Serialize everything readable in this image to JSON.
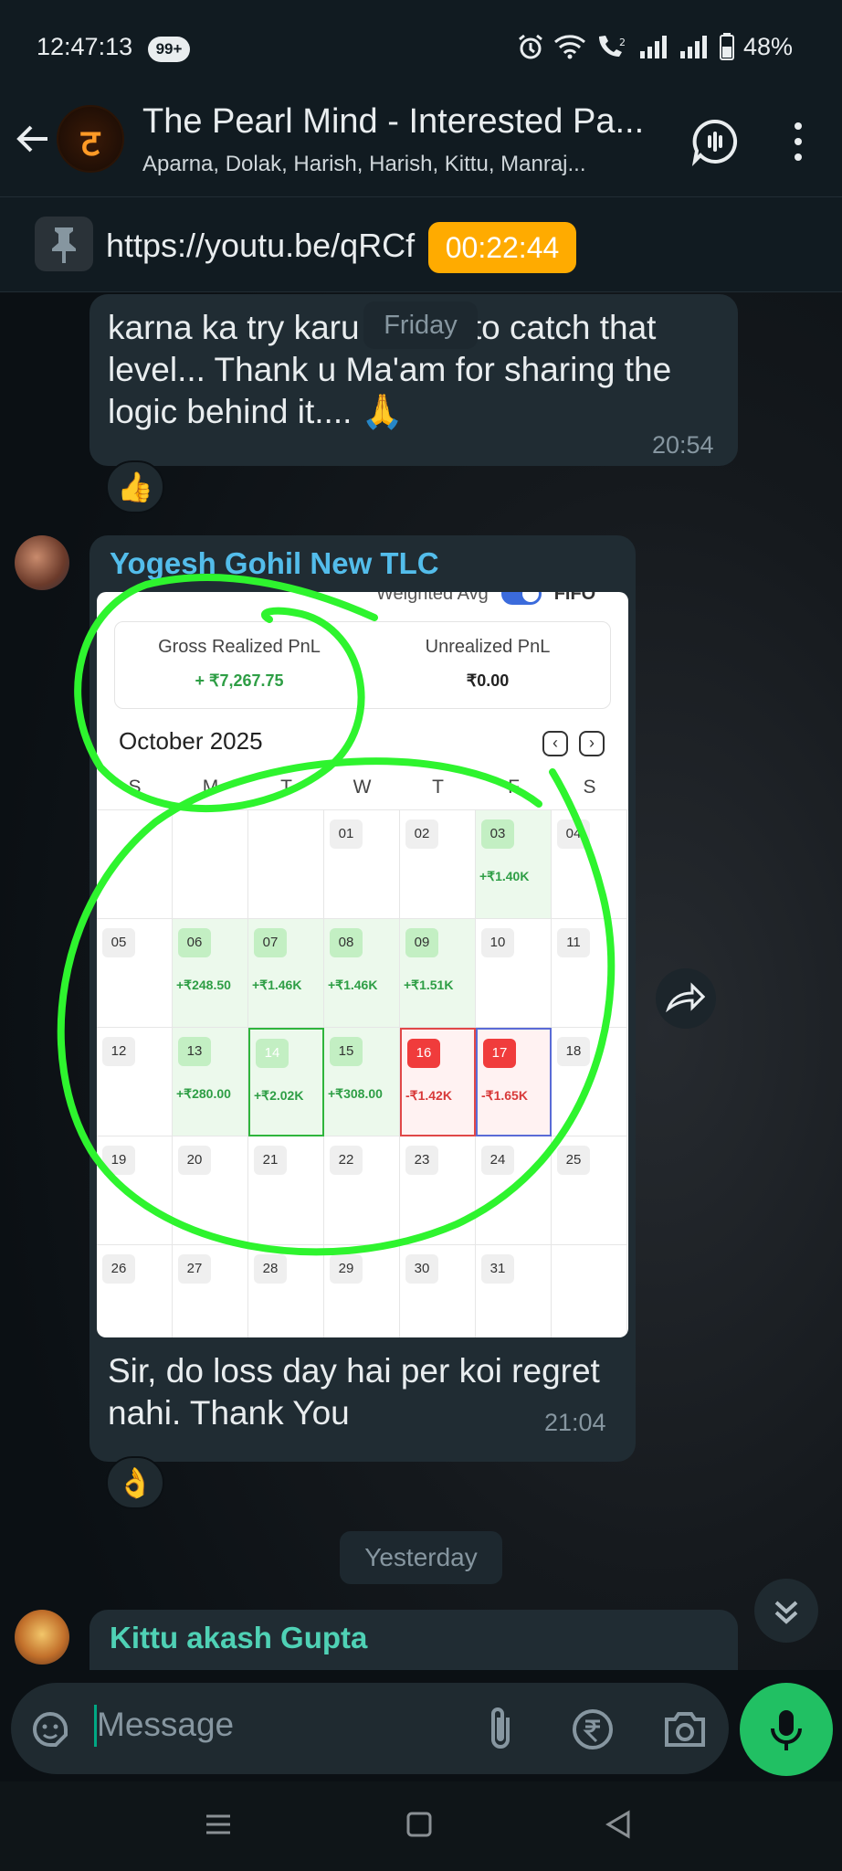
{
  "status_bar": {
    "time": "12:47:13",
    "badge": "99+",
    "battery": "48%"
  },
  "header": {
    "title": "The Pearl Mind - Interested Pa...",
    "subtitle": "Aparna, Dolak, Harish, Harish, Kittu, Manraj...",
    "avatar_glyph": "ट"
  },
  "pinned": {
    "url": "https://youtu.be/qRCf",
    "timer": "00:22:44"
  },
  "date_chip_friday": "Friday",
  "message1": {
    "text": "karna ka try karu    will try to catch that level... Thank u Ma'am for sharing the logic behind it.... 🙏",
    "time": "20:54",
    "reaction": "👍"
  },
  "message2": {
    "sender": "Yogesh Gohil New TLC",
    "sender_color": "#53bdeb",
    "caption": "Sir, do loss day hai per koi regret nahi. Thank You",
    "time": "21:04",
    "reaction": "👌",
    "image": {
      "toggle_left": "Weighted Avg",
      "toggle_right": "FIFO",
      "gross_label": "Gross Realized PnL",
      "gross_value": "+ ₹7,267.75",
      "unrealized_label": "Unrealized PnL",
      "unrealized_value": "₹0.00",
      "month": "October 2025",
      "weekdays": [
        "S",
        "M",
        "T",
        "W",
        "T",
        "F",
        "S"
      ],
      "days": [
        {
          "d": "",
          "v": "",
          "s": ""
        },
        {
          "d": "",
          "v": "",
          "s": ""
        },
        {
          "d": "",
          "v": "",
          "s": ""
        },
        {
          "d": "01",
          "v": "",
          "s": ""
        },
        {
          "d": "02",
          "v": "",
          "s": ""
        },
        {
          "d": "03",
          "v": "+₹1.40K",
          "s": "pos"
        },
        {
          "d": "04",
          "v": "",
          "s": ""
        },
        {
          "d": "05",
          "v": "",
          "s": ""
        },
        {
          "d": "06",
          "v": "+₹248.50",
          "s": "pos"
        },
        {
          "d": "07",
          "v": "+₹1.46K",
          "s": "pos"
        },
        {
          "d": "08",
          "v": "+₹1.46K",
          "s": "pos"
        },
        {
          "d": "09",
          "v": "+₹1.51K",
          "s": "pos"
        },
        {
          "d": "10",
          "v": "",
          "s": ""
        },
        {
          "d": "11",
          "v": "",
          "s": ""
        },
        {
          "d": "12",
          "v": "",
          "s": ""
        },
        {
          "d": "13",
          "v": "+₹280.00",
          "s": "pos"
        },
        {
          "d": "14",
          "v": "+₹2.02K",
          "s": "pos-sel"
        },
        {
          "d": "15",
          "v": "+₹308.00",
          "s": "pos"
        },
        {
          "d": "16",
          "v": "-₹1.42K",
          "s": "neg"
        },
        {
          "d": "17",
          "v": "-₹1.65K",
          "s": "neg-today"
        },
        {
          "d": "18",
          "v": "",
          "s": ""
        },
        {
          "d": "19",
          "v": "",
          "s": ""
        },
        {
          "d": "20",
          "v": "",
          "s": ""
        },
        {
          "d": "21",
          "v": "",
          "s": ""
        },
        {
          "d": "22",
          "v": "",
          "s": ""
        },
        {
          "d": "23",
          "v": "",
          "s": ""
        },
        {
          "d": "24",
          "v": "",
          "s": ""
        },
        {
          "d": "25",
          "v": "",
          "s": ""
        },
        {
          "d": "26",
          "v": "",
          "s": ""
        },
        {
          "d": "27",
          "v": "",
          "s": ""
        },
        {
          "d": "28",
          "v": "",
          "s": ""
        },
        {
          "d": "29",
          "v": "",
          "s": ""
        },
        {
          "d": "30",
          "v": "",
          "s": ""
        },
        {
          "d": "31",
          "v": "",
          "s": ""
        },
        {
          "d": "",
          "v": "",
          "s": ""
        }
      ]
    }
  },
  "date_chip_yesterday": "Yesterday",
  "message3": {
    "sender": "Kittu akash Gupta",
    "sender_color": "#4fd1b5"
  },
  "composer": {
    "placeholder": "Message"
  },
  "colors": {
    "accent_green": "#21c063",
    "timer_amber": "#ffab00",
    "annotation_green": "#2ef42e"
  }
}
